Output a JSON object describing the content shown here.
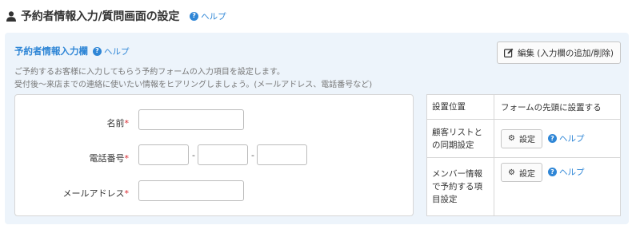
{
  "header": {
    "title": "予約者情報入力/質問画面の設定",
    "help": "ヘルプ"
  },
  "section": {
    "title": "予約者情報入力欄",
    "help": "ヘルプ",
    "edit_button": "編集 (入力欄の追加/削除)",
    "description_1": "ご予約するお客様に入力してもらう予約フォームの入力項目を設定します。",
    "description_2": "受付後〜来店までの連絡に使いたい情報をヒアリングしましょう。(メールアドレス、電話番号など)"
  },
  "form": {
    "name_label": "名前",
    "phone_label": "電話番号",
    "email_label": "メールアドレス",
    "required_mark": "*",
    "phone_separator": "-"
  },
  "settings": {
    "position_label": "設置位置",
    "position_value": "フォームの先頭に設置する",
    "sync_label": "顧客リストとの同期設定",
    "member_label": "メンバー情報で予約する項目設定",
    "setting_button": "設定",
    "help": "ヘルプ"
  },
  "colors": {
    "accent": "#2f86d6",
    "panel_bg": "#edf4fb",
    "required": "#d9282f"
  }
}
